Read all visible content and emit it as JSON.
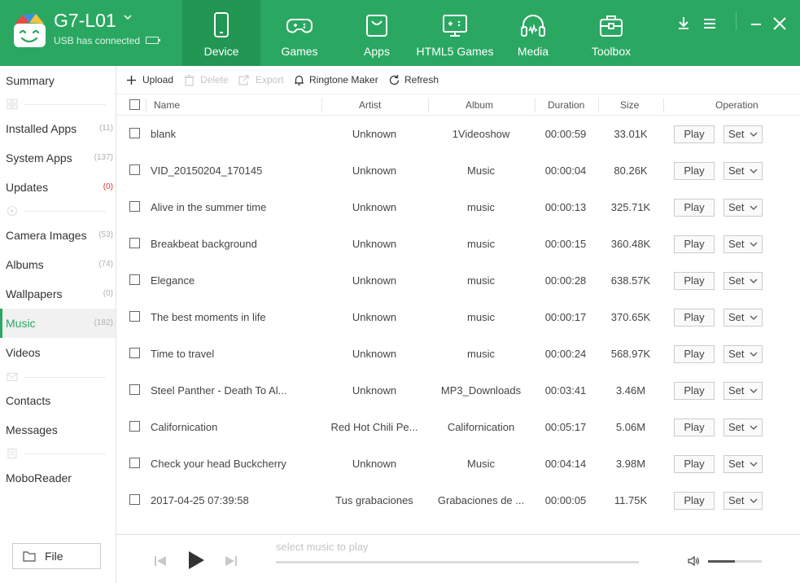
{
  "header": {
    "device_name": "G7-L01",
    "connection_status": "USB has connected",
    "tabs": [
      {
        "label": "Device",
        "icon": "phone-icon",
        "active": true
      },
      {
        "label": "Games",
        "icon": "gamepad-icon",
        "active": false
      },
      {
        "label": "Apps",
        "icon": "shopping-bag-icon",
        "active": false
      },
      {
        "label": "HTML5 Games",
        "icon": "html5-games-icon",
        "active": false
      },
      {
        "label": "Media",
        "icon": "headphones-icon",
        "active": false
      },
      {
        "label": "Toolbox",
        "icon": "toolbox-icon",
        "active": false
      }
    ],
    "window_controls": [
      "download-icon",
      "menu-icon",
      "minimize-icon",
      "close-icon"
    ]
  },
  "sidebar": {
    "items": [
      {
        "label": "Summary",
        "count": ""
      },
      {
        "label": "Installed Apps",
        "count": "(11)"
      },
      {
        "label": "System Apps",
        "count": "(137)"
      },
      {
        "label": "Updates",
        "count": "(0)"
      },
      {
        "label": "Camera Images",
        "count": "(53)"
      },
      {
        "label": "Albums",
        "count": "(74)"
      },
      {
        "label": "Wallpapers",
        "count": "(0)"
      },
      {
        "label": "Music",
        "count": "(182)"
      },
      {
        "label": "Videos",
        "count": ""
      },
      {
        "label": "Contacts",
        "count": ""
      },
      {
        "label": "Messages",
        "count": ""
      },
      {
        "label": "MoboReader",
        "count": ""
      }
    ],
    "active_item": "Music",
    "file_button": "File"
  },
  "toolbar": {
    "upload": "Upload",
    "delete": "Delete",
    "export": "Export",
    "ringtone_maker": "Ringtone Maker",
    "refresh": "Refresh"
  },
  "table": {
    "columns": {
      "name": "Name",
      "artist": "Artist",
      "album": "Album",
      "duration": "Duration",
      "size": "Size",
      "operation": "Operation"
    },
    "play_label": "Play",
    "set_label": "Set",
    "rows": [
      {
        "name": "blank",
        "artist": "Unknown",
        "album": "1Videoshow",
        "duration": "00:00:59",
        "size": "33.01K"
      },
      {
        "name": "VID_20150204_170145",
        "artist": "Unknown",
        "album": "Music",
        "duration": "00:00:04",
        "size": "80.26K"
      },
      {
        "name": "Alive in the summer time",
        "artist": "Unknown",
        "album": "music",
        "duration": "00:00:13",
        "size": "325.71K"
      },
      {
        "name": "Breakbeat background",
        "artist": "Unknown",
        "album": "music",
        "duration": "00:00:15",
        "size": "360.48K"
      },
      {
        "name": "Elegance",
        "artist": "Unknown",
        "album": "music",
        "duration": "00:00:28",
        "size": "638.57K"
      },
      {
        "name": "The best moments in life",
        "artist": "Unknown",
        "album": "music",
        "duration": "00:00:17",
        "size": "370.65K"
      },
      {
        "name": "Time to travel",
        "artist": "Unknown",
        "album": "music",
        "duration": "00:00:24",
        "size": "568.97K"
      },
      {
        "name": "Steel Panther - Death To Al...",
        "artist": "Unknown",
        "album": "MP3_Downloads",
        "duration": "00:03:41",
        "size": "3.46M"
      },
      {
        "name": "Californication",
        "artist": "Red Hot Chili Pe...",
        "album": "Californication",
        "duration": "00:05:17",
        "size": "5.06M"
      },
      {
        "name": "Check your head Buckcherry",
        "artist": "Unknown",
        "album": "Music",
        "duration": "00:04:14",
        "size": "3.98M"
      },
      {
        "name": "2017-04-25 07:39:58",
        "artist": "Tus grabaciones",
        "album": "Grabaciones de ...",
        "duration": "00:00:05",
        "size": "11.75K"
      }
    ]
  },
  "player": {
    "status_text": "select music to play",
    "volume_level": 0.5
  },
  "colors": {
    "brand_green": "#2aa862",
    "active_tab_green": "#229653",
    "count_red": "#d33333"
  }
}
